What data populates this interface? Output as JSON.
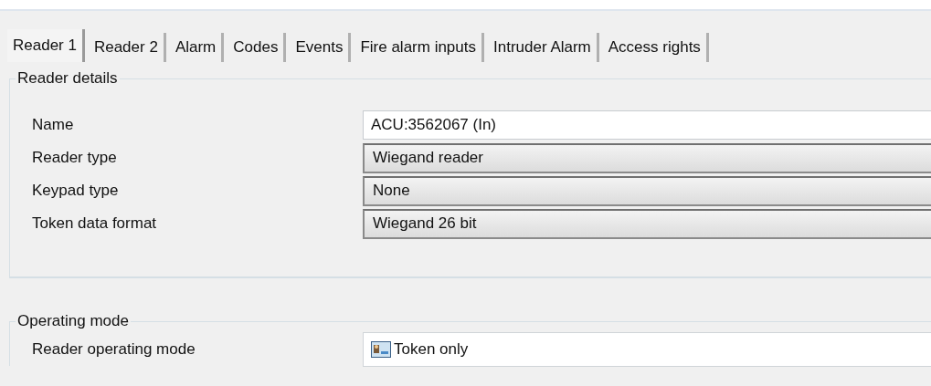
{
  "tabs": [
    {
      "label": "Reader 1",
      "selected": true
    },
    {
      "label": "Reader 2",
      "selected": false
    },
    {
      "label": "Alarm",
      "selected": false
    },
    {
      "label": "Codes",
      "selected": false
    },
    {
      "label": "Events",
      "selected": false
    },
    {
      "label": "Fire alarm inputs",
      "selected": false
    },
    {
      "label": "Intruder Alarm",
      "selected": false
    },
    {
      "label": "Access rights",
      "selected": false
    }
  ],
  "groups": [
    {
      "title": "Reader details",
      "rows": [
        {
          "label": "Name",
          "kind": "text",
          "value": "ACU:3562067 (In)"
        },
        {
          "label": "Reader type",
          "kind": "dropdown",
          "value": "Wiegand reader"
        },
        {
          "label": "Keypad type",
          "kind": "dropdown",
          "value": "None"
        },
        {
          "label": "Token data format",
          "kind": "dropdown",
          "value": "Wiegand 26 bit"
        }
      ]
    },
    {
      "title": "Operating mode",
      "rows": [
        {
          "label": "Reader operating mode",
          "kind": "icon-text",
          "value": "Token only"
        }
      ]
    }
  ]
}
